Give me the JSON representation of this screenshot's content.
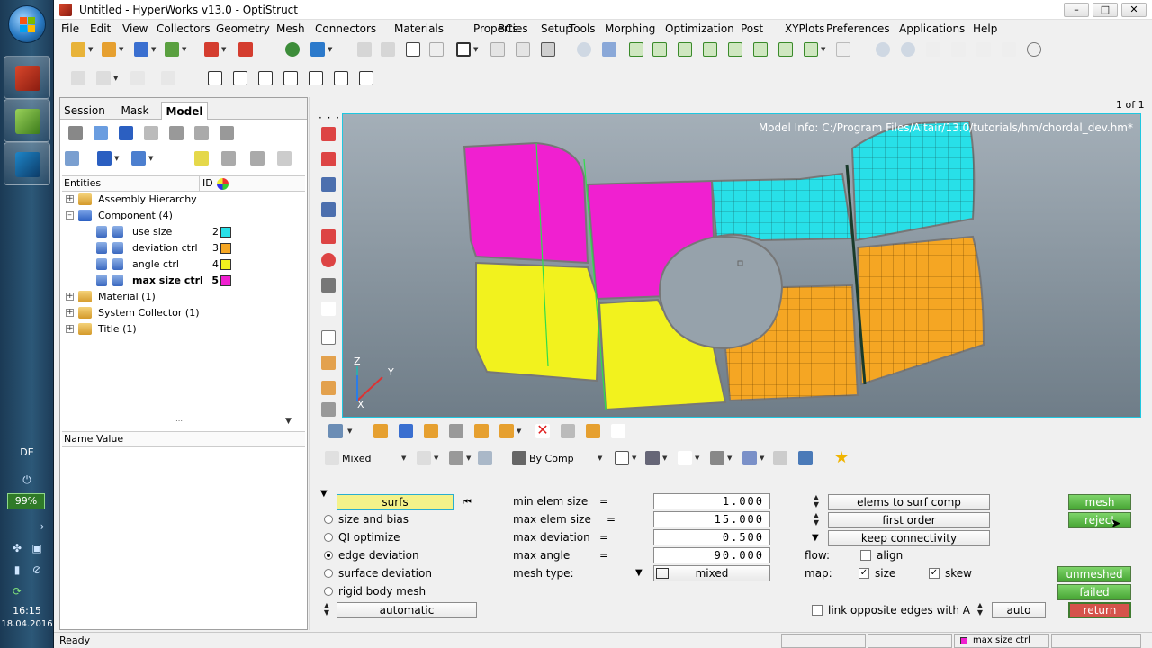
{
  "taskbar": {
    "lang": "DE",
    "battery": "99%",
    "time": "16:15",
    "date": "18.04.2016"
  },
  "window": {
    "title": "Untitled - HyperWorks v13.0 - OptiStruct",
    "controls": [
      "–",
      "□",
      "✕"
    ]
  },
  "menu": [
    "File",
    "Edit",
    "View",
    "Collectors",
    "Geometry",
    "Mesh",
    "Connectors",
    "Materials",
    "Properties",
    "BCs",
    "Setup",
    "Tools",
    "Morphing",
    "Optimization",
    "Post",
    "XYPlots",
    "Preferences",
    "Applications",
    "Help"
  ],
  "browser": {
    "tabs": [
      "Session",
      "Mask",
      "Model"
    ],
    "active_tab": "Model",
    "columns": {
      "entities": "Entities",
      "id": "ID"
    },
    "tree": [
      {
        "label": "Assembly Hierarchy",
        "level": 0,
        "expander": "+"
      },
      {
        "label": "Component (4)",
        "level": 0,
        "expander": "–"
      },
      {
        "label": "use size",
        "level": 1,
        "id": "2",
        "color": "#28e0e8"
      },
      {
        "label": "deviation ctrl",
        "level": 1,
        "id": "3",
        "color": "#f5a623"
      },
      {
        "label": "angle ctrl",
        "level": 1,
        "id": "4",
        "color": "#f2f21e"
      },
      {
        "label": "max size ctrl",
        "level": 1,
        "id": "5",
        "color": "#f020d0",
        "bold": true
      },
      {
        "label": "Material (1)",
        "level": 0,
        "expander": "+"
      },
      {
        "label": "System Collector (1)",
        "level": 0,
        "expander": "+"
      },
      {
        "label": "Title (1)",
        "level": 0,
        "expander": "+"
      }
    ],
    "name_value": "Name Value"
  },
  "graphics": {
    "page": "1 of 1",
    "model_info": "Model Info: C:/Program Files/Altair/13.0/tutorials/hm/chordal_dev.hm*",
    "triad": {
      "z": "Z",
      "y": "Y",
      "x": "X"
    }
  },
  "vis_toolbar": {
    "mode": "Mixed",
    "color_by": "By Comp"
  },
  "panel": {
    "entity_button": "surfs",
    "modes": [
      {
        "label": "size and bias",
        "selected": false
      },
      {
        "label": "QI optimize",
        "selected": false
      },
      {
        "label": "edge deviation",
        "selected": true
      },
      {
        "label": "surface deviation",
        "selected": false
      },
      {
        "label": "rigid body mesh",
        "selected": false
      }
    ],
    "auto_button": "automatic",
    "params": [
      {
        "label": "min elem size",
        "eq": "=",
        "value": "1.000"
      },
      {
        "label": "max elem size",
        "eq": "=",
        "value": "15.000"
      },
      {
        "label": "max deviation",
        "eq": "=",
        "value": "0.500"
      },
      {
        "label": "max angle",
        "eq": "=",
        "value": "90.000"
      }
    ],
    "mesh_type_label": "mesh type:",
    "mesh_type_value": "mixed",
    "toggles": [
      "elems to surf comp",
      "first order",
      "keep connectivity"
    ],
    "flow_label": "flow:",
    "align": {
      "label": "align",
      "checked": false
    },
    "map_label": "map:",
    "size": {
      "label": "size",
      "checked": true
    },
    "skew": {
      "label": "skew",
      "checked": true
    },
    "link": {
      "label": "link opposite edges with A",
      "checked": false
    },
    "auto_small": "auto",
    "mesh_btn": "mesh",
    "reject_btn": "reject",
    "unmeshed_btn": "unmeshed",
    "failed_btn": "failed",
    "return_btn": "return"
  },
  "status": {
    "text": "Ready",
    "component": "max size ctrl",
    "component_color": "#f020d0"
  },
  "colors": {
    "cyan": "#28e0e8",
    "orange": "#f5a623",
    "yellow": "#f2f21e",
    "magenta": "#f020d0",
    "gfx_border": "#1fc7e0"
  }
}
